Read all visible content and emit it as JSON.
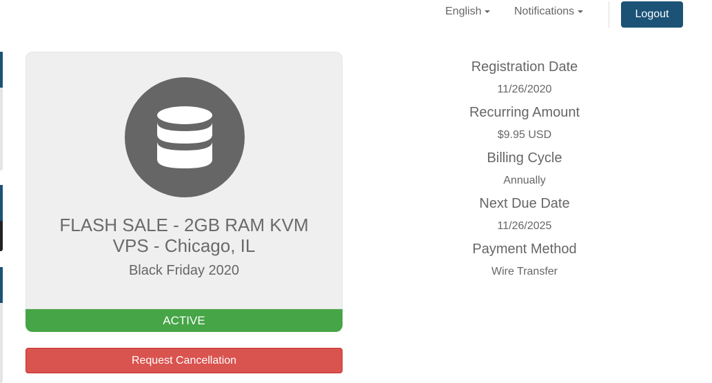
{
  "nav": {
    "language_label": "English",
    "notifications_label": "Notifications",
    "logout_label": "Logout"
  },
  "product": {
    "icon": "database-icon",
    "title": "FLASH SALE - 2GB RAM KVM VPS - Chicago, IL",
    "group": "Black Friday 2020",
    "status": "ACTIVE"
  },
  "actions": {
    "request_cancellation_label": "Request Cancellation"
  },
  "details": [
    {
      "label": "Registration Date",
      "value": "11/26/2020"
    },
    {
      "label": "Recurring Amount",
      "value": "$9.95 USD"
    },
    {
      "label": "Billing Cycle",
      "value": "Annually"
    },
    {
      "label": "Next Due Date",
      "value": "11/26/2025"
    },
    {
      "label": "Payment Method",
      "value": "Wire Transfer"
    }
  ],
  "colors": {
    "brand": "#1b5276",
    "active": "#46a546",
    "danger": "#d9534f",
    "icon_bg": "#666666"
  }
}
